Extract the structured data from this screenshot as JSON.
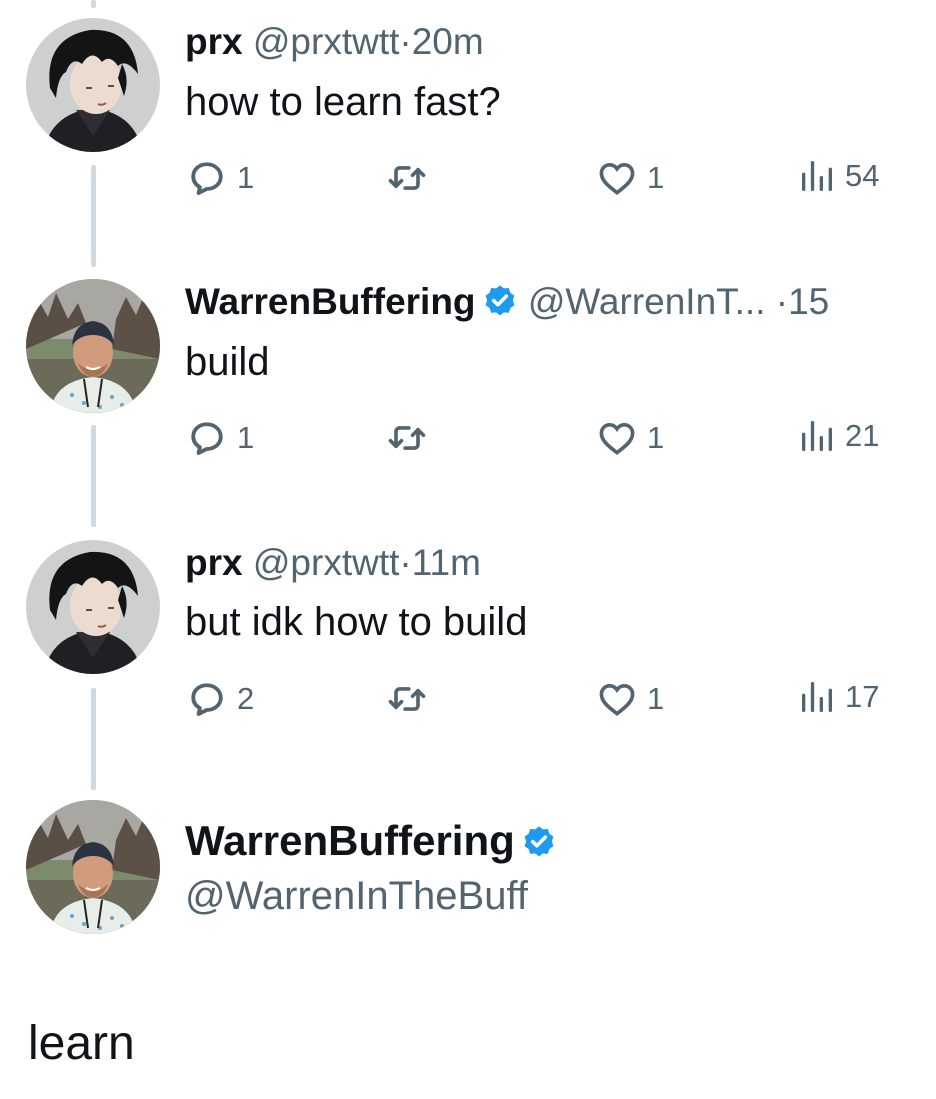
{
  "tweets": [
    {
      "author": "prx",
      "handle": "@prxtwtt",
      "sep": "·",
      "time": "20m",
      "verified": false,
      "text": "how to learn fast?",
      "replies": "1",
      "likes": "1",
      "views": "54"
    },
    {
      "author": "WarrenBuffering",
      "handle": "@WarrenInT...",
      "sep": "·",
      "time": "15",
      "verified": true,
      "text": "build",
      "replies": "1",
      "likes": "1",
      "views": "21"
    },
    {
      "author": "prx",
      "handle": "@prxtwtt",
      "sep": "·",
      "time": "11m",
      "verified": false,
      "text": "but idk how to build",
      "replies": "2",
      "likes": "1",
      "views": "17"
    }
  ],
  "main_tweet": {
    "author": "WarrenBuffering",
    "handle": "@WarrenInTheBuff",
    "verified": true,
    "text": "learn"
  },
  "icons": {
    "reply": "speech-bubble-icon",
    "retweet": "retweet-arrows-icon",
    "like": "heart-icon",
    "views": "bar-chart-icon",
    "verified": "verified-badge-icon"
  },
  "colors": {
    "text": "#0f1419",
    "muted": "#536471",
    "verified": "#1d9bf0",
    "thread_line": "#cfd9de"
  }
}
